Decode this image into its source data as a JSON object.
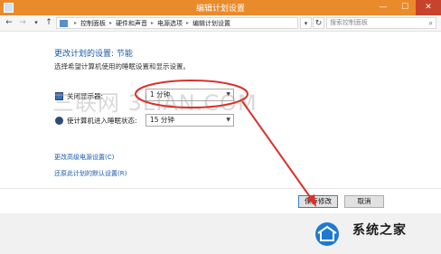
{
  "window": {
    "title": "编辑计划设置",
    "min_glyph": "—",
    "max_glyph": "☐",
    "close_glyph": "✕"
  },
  "nav": {
    "back_glyph": "←",
    "forward_glyph": "→",
    "dropdown_glyph": "▾",
    "up_glyph": "↑",
    "refresh_glyph": "↻"
  },
  "breadcrumb": [
    "控制面板",
    "硬件和声音",
    "电源选项",
    "编辑计划设置"
  ],
  "breadcrumb_sep": "▸",
  "search": {
    "placeholder": "搜索控制面板"
  },
  "main": {
    "title": "更改计划的设置: 节能",
    "subtitle": "选择希望计算机使用的睡眠设置和显示设置。",
    "display_label": "关闭显示器:",
    "display_value": "1 分钟",
    "sleep_label": "使计算机进入睡眠状态:",
    "sleep_value": "15 分钟",
    "link_advanced": "更改高级电源设置(C)",
    "link_restore": "还原此计划的默认设置(R)"
  },
  "buttons": {
    "save": "保存修改",
    "cancel": "取消"
  },
  "watermark": "三联网 3LIAN.COM",
  "logo_text": "系统之家",
  "colors": {
    "titlebar": "#e98a2b",
    "annotation": "#d9322a",
    "link": "#1a5aa8"
  }
}
